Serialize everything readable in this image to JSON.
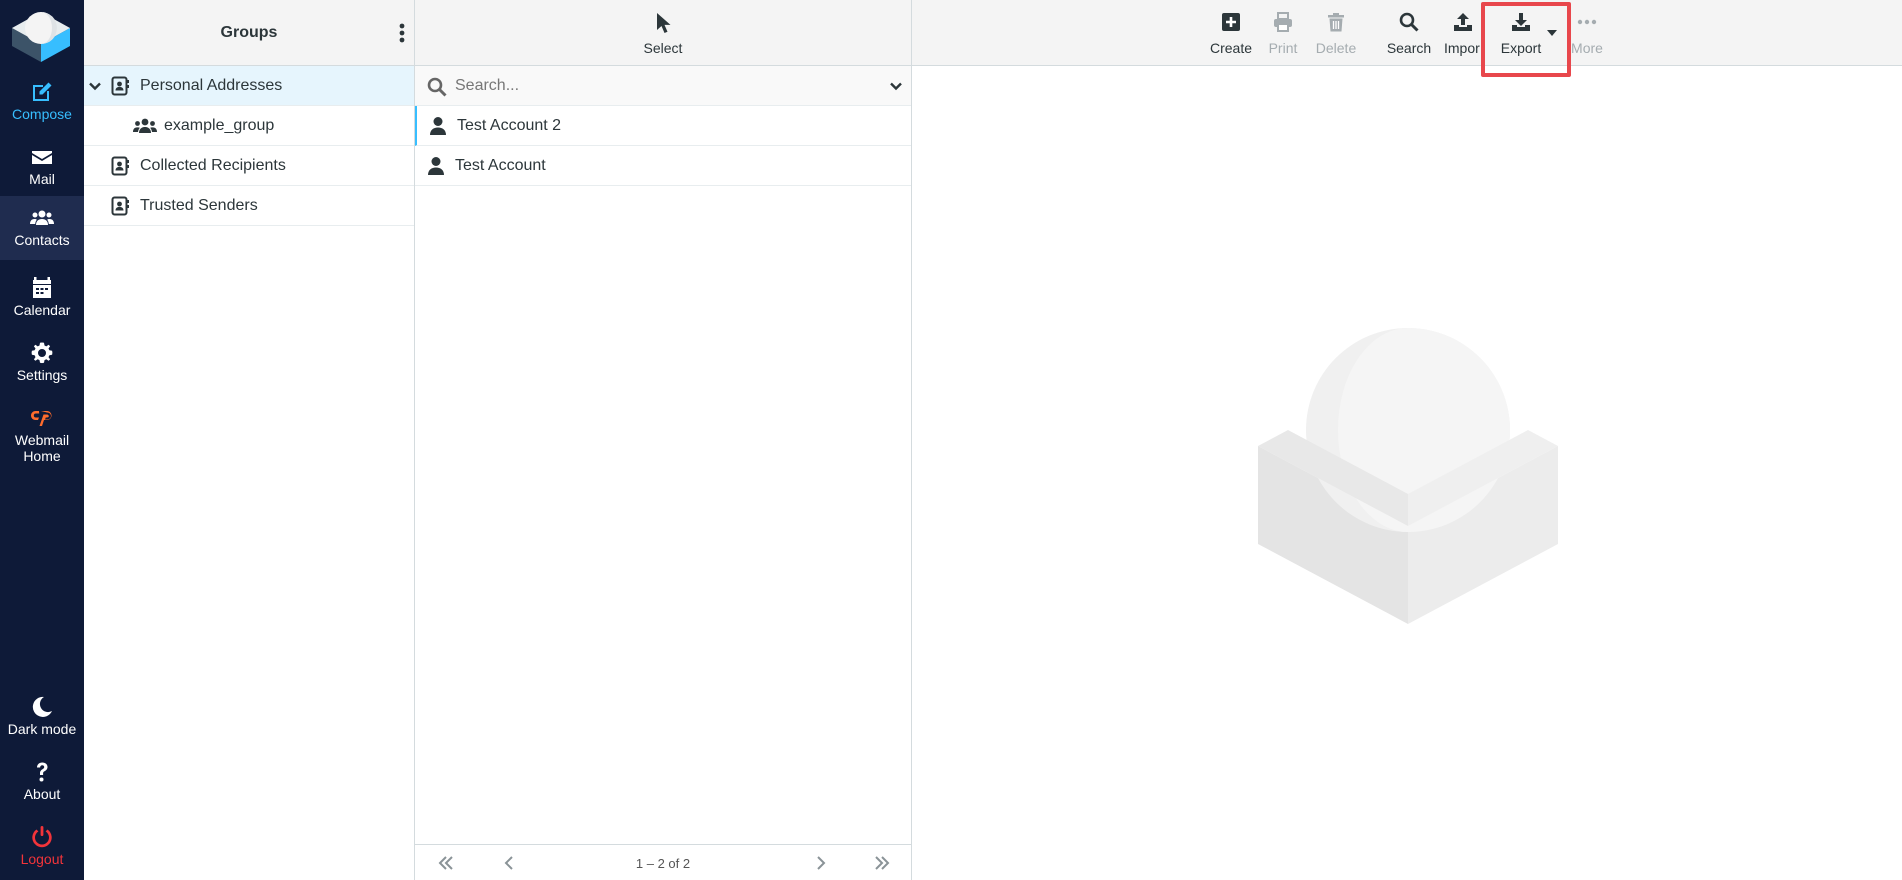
{
  "nav": {
    "compose": "Compose",
    "mail": "Mail",
    "contacts": "Contacts",
    "calendar": "Calendar",
    "settings": "Settings",
    "webmail_home": "Webmail Home",
    "dark_mode": "Dark mode",
    "about": "About",
    "logout": "Logout",
    "selected": "contacts"
  },
  "groups_panel": {
    "title": "Groups",
    "items": [
      {
        "label": "Personal Addresses",
        "icon": "address-book-icon",
        "selected": true,
        "expanded": true
      },
      {
        "label": "example_group",
        "icon": "users-icon",
        "indent": true
      },
      {
        "label": "Collected Recipients",
        "icon": "address-book-icon"
      },
      {
        "label": "Trusted Senders",
        "icon": "address-book-icon"
      }
    ]
  },
  "list_panel": {
    "select_label": "Select",
    "search_placeholder": "Search...",
    "contacts": [
      {
        "name": "Test Account 2"
      },
      {
        "name": "Test Account"
      }
    ],
    "pagination": "1 – 2 of 2"
  },
  "toolbar": {
    "create": "Create",
    "print": "Print",
    "delete": "Delete",
    "search": "Search",
    "import": "Impor",
    "export": "Export",
    "more": "More"
  },
  "colors": {
    "nav_bg": "#0e1a38",
    "accent": "#37beff",
    "logout": "#f2343a",
    "highlight": "#e8474c"
  }
}
